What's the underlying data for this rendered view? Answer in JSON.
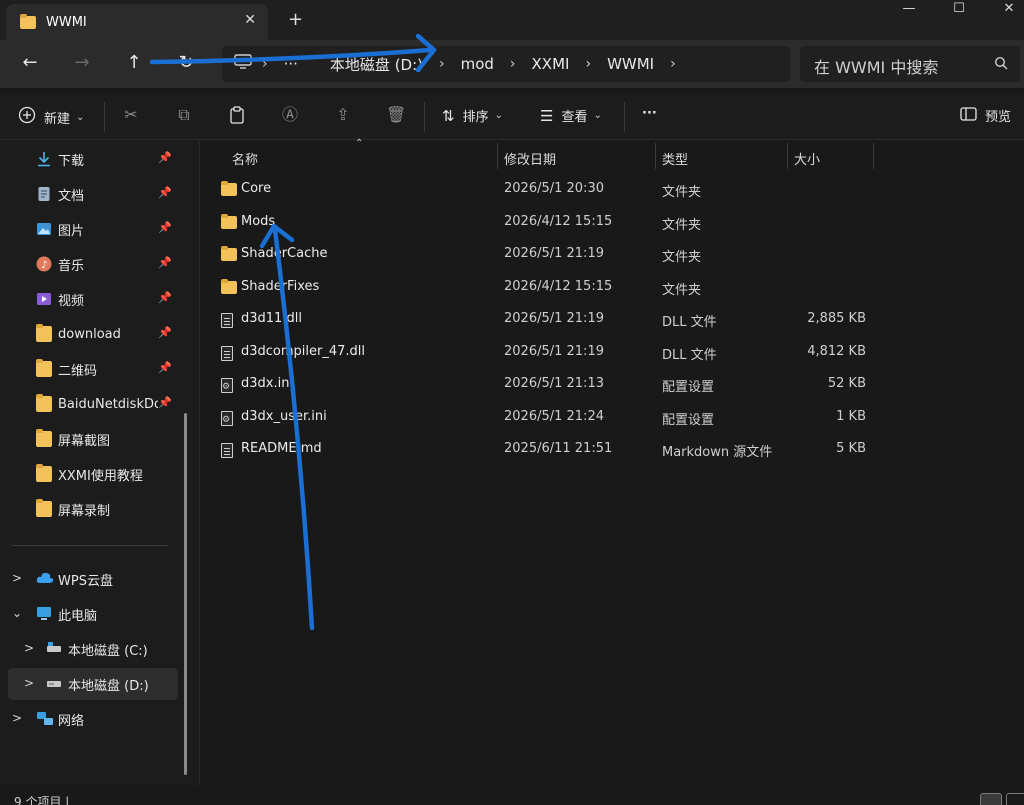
{
  "window": {
    "tab_title": "WWMI",
    "tab_close": "✕",
    "new_tab": "+",
    "minimize": "—",
    "maximize": "☐",
    "close": "✕"
  },
  "nav": {
    "back": "←",
    "forward": "→",
    "up": "↑",
    "refresh": "↻",
    "more_crumbs": "···",
    "breadcrumbs": [
      "本地磁盘 (D:)",
      "mod",
      "XXMI",
      "WWMI"
    ],
    "search_placeholder": "在 WWMI 中搜索"
  },
  "toolbar": {
    "new_label": "新建",
    "sort_label": "排序",
    "view_label": "查看",
    "more_label": "···",
    "preview_label": "预览"
  },
  "sidebar": {
    "pinned": [
      {
        "label": "下载",
        "icon": "download-icon"
      },
      {
        "label": "文档",
        "icon": "document-icon"
      },
      {
        "label": "图片",
        "icon": "pictures-icon"
      },
      {
        "label": "音乐",
        "icon": "music-icon"
      },
      {
        "label": "视频",
        "icon": "video-icon"
      },
      {
        "label": "download",
        "icon": "folder-icon"
      },
      {
        "label": "二维码",
        "icon": "folder-icon"
      },
      {
        "label": "BaiduNetdiskDo",
        "icon": "folder-icon"
      },
      {
        "label": "屏幕截图",
        "icon": "folder-icon"
      },
      {
        "label": "XXMI使用教程",
        "icon": "folder-icon"
      },
      {
        "label": "屏幕录制",
        "icon": "folder-icon"
      }
    ],
    "tree": [
      {
        "label": "WPS云盘",
        "chevron": ">"
      },
      {
        "label": "此电脑",
        "chevron": "⌄"
      },
      {
        "label": "本地磁盘 (C:)",
        "chevron": ">"
      },
      {
        "label": "本地磁盘 (D:)",
        "chevron": ">"
      },
      {
        "label": "网络",
        "chevron": ">"
      }
    ]
  },
  "columns": {
    "name": "名称",
    "date": "修改日期",
    "type": "类型",
    "size": "大小"
  },
  "files": [
    {
      "name": "Core",
      "date": "2026/5/1 20:30",
      "type": "文件夹",
      "size": "",
      "kind": "folder"
    },
    {
      "name": "Mods",
      "date": "2026/4/12 15:15",
      "type": "文件夹",
      "size": "",
      "kind": "folder"
    },
    {
      "name": "ShaderCache",
      "date": "2026/5/1 21:19",
      "type": "文件夹",
      "size": "",
      "kind": "folder"
    },
    {
      "name": "ShaderFixes",
      "date": "2026/4/12 15:15",
      "type": "文件夹",
      "size": "",
      "kind": "folder"
    },
    {
      "name": "d3d11.dll",
      "date": "2026/5/1 21:19",
      "type": "DLL 文件",
      "size": "2,885 KB",
      "kind": "file"
    },
    {
      "name": "d3dcompiler_47.dll",
      "date": "2026/5/1 21:19",
      "type": "DLL 文件",
      "size": "4,812 KB",
      "kind": "file"
    },
    {
      "name": "d3dx.ini",
      "date": "2026/5/1 21:13",
      "type": "配置设置",
      "size": "52 KB",
      "kind": "ini"
    },
    {
      "name": "d3dx_user.ini",
      "date": "2026/5/1 21:24",
      "type": "配置设置",
      "size": "1 KB",
      "kind": "ini"
    },
    {
      "name": "README.md",
      "date": "2025/6/11 21:51",
      "type": "Markdown 源文件",
      "size": "5 KB",
      "kind": "file"
    }
  ],
  "status": {
    "count_text": "9 个项目 |"
  },
  "colors": {
    "accent_arrow": "#1a6fd4",
    "folder": "#f3c25b"
  }
}
